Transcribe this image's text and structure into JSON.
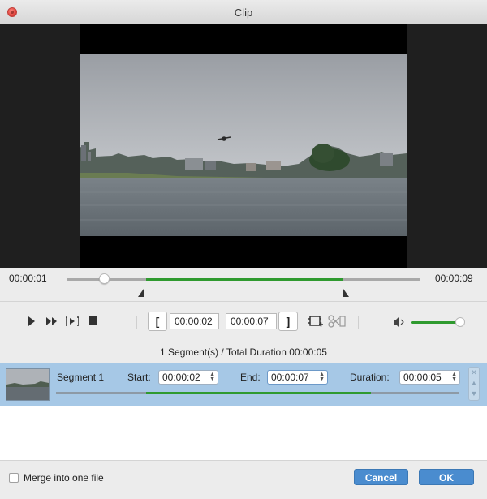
{
  "window": {
    "title": "Clip"
  },
  "timeline": {
    "start_time": "00:00:01",
    "end_time": "00:00:09",
    "playhead_position": 0.1,
    "range_start": 0.22,
    "range_end": 0.78
  },
  "controls": {
    "icons": [
      "play-icon",
      "fast-forward-icon",
      "step-icon",
      "stop-icon",
      "film-add-icon",
      "scissors-icon",
      "volume-icon"
    ],
    "start_bracket": "[",
    "end_bracket": "]",
    "segment_start": "00:00:02",
    "segment_end": "00:00:07",
    "volume_level": 0.9
  },
  "summary": {
    "text": "1 Segment(s) / Total Duration 00:00:05"
  },
  "segment": {
    "name": "Segment 1",
    "start_label": "Start:",
    "start_value": "00:00:02",
    "end_label": "End:",
    "end_value": "00:00:07",
    "duration_label": "Duration:",
    "duration_value": "00:00:05"
  },
  "footer": {
    "merge_label": "Merge into one file",
    "merge_checked": false,
    "cancel_label": "Cancel",
    "ok_label": "OK"
  },
  "colors": {
    "accent_green": "#2f9a2f",
    "selection_blue": "#a6c8e6",
    "button_blue": "#4a8ccf"
  }
}
